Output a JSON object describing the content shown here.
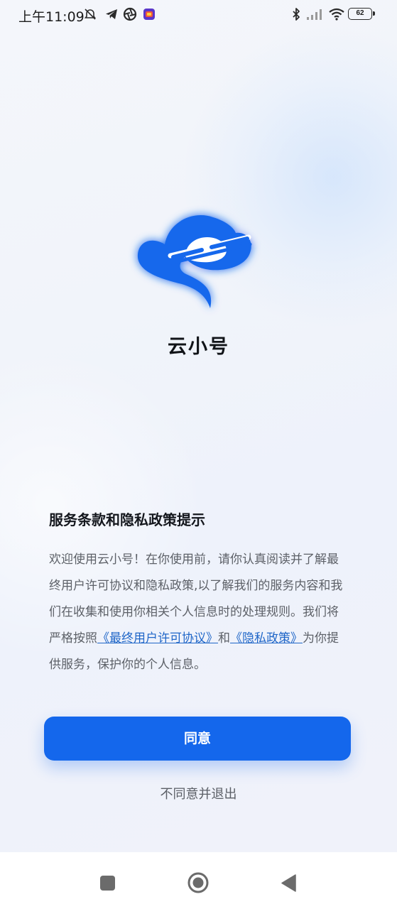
{
  "status_bar": {
    "time": "上午11:09",
    "battery_level": "62",
    "icons": [
      "muted-alarm-icon",
      "telegram-icon",
      "aperture-icon",
      "app-notification-icon",
      "bluetooth-icon",
      "signal-icon",
      "wifi-icon",
      "battery-icon"
    ]
  },
  "app": {
    "name": "云小号",
    "logo_icon": "cloud-phone-logo-icon",
    "brand_color": "#1467ec"
  },
  "terms": {
    "title": "服务条款和隐私政策提示",
    "text_1": "欢迎使用云小号！在你使用前，请你认真阅读并了解最终用户许可协议和隐私政策,以了解我们的服务内容和我们在收集和使用你相关个人信息时的处理规则。我们将严格按照",
    "link_eula": "《最终用户许可协议》",
    "text_2": "和",
    "link_privacy": "《隐私政策》",
    "text_3": "为你提供服务，保护你的个人信息。",
    "link_color": "#1f66c8"
  },
  "actions": {
    "agree_label": "同意",
    "disagree_label": "不同意并退出"
  },
  "nav_bar": {
    "icons": [
      "recents-icon",
      "home-icon",
      "back-icon"
    ]
  }
}
